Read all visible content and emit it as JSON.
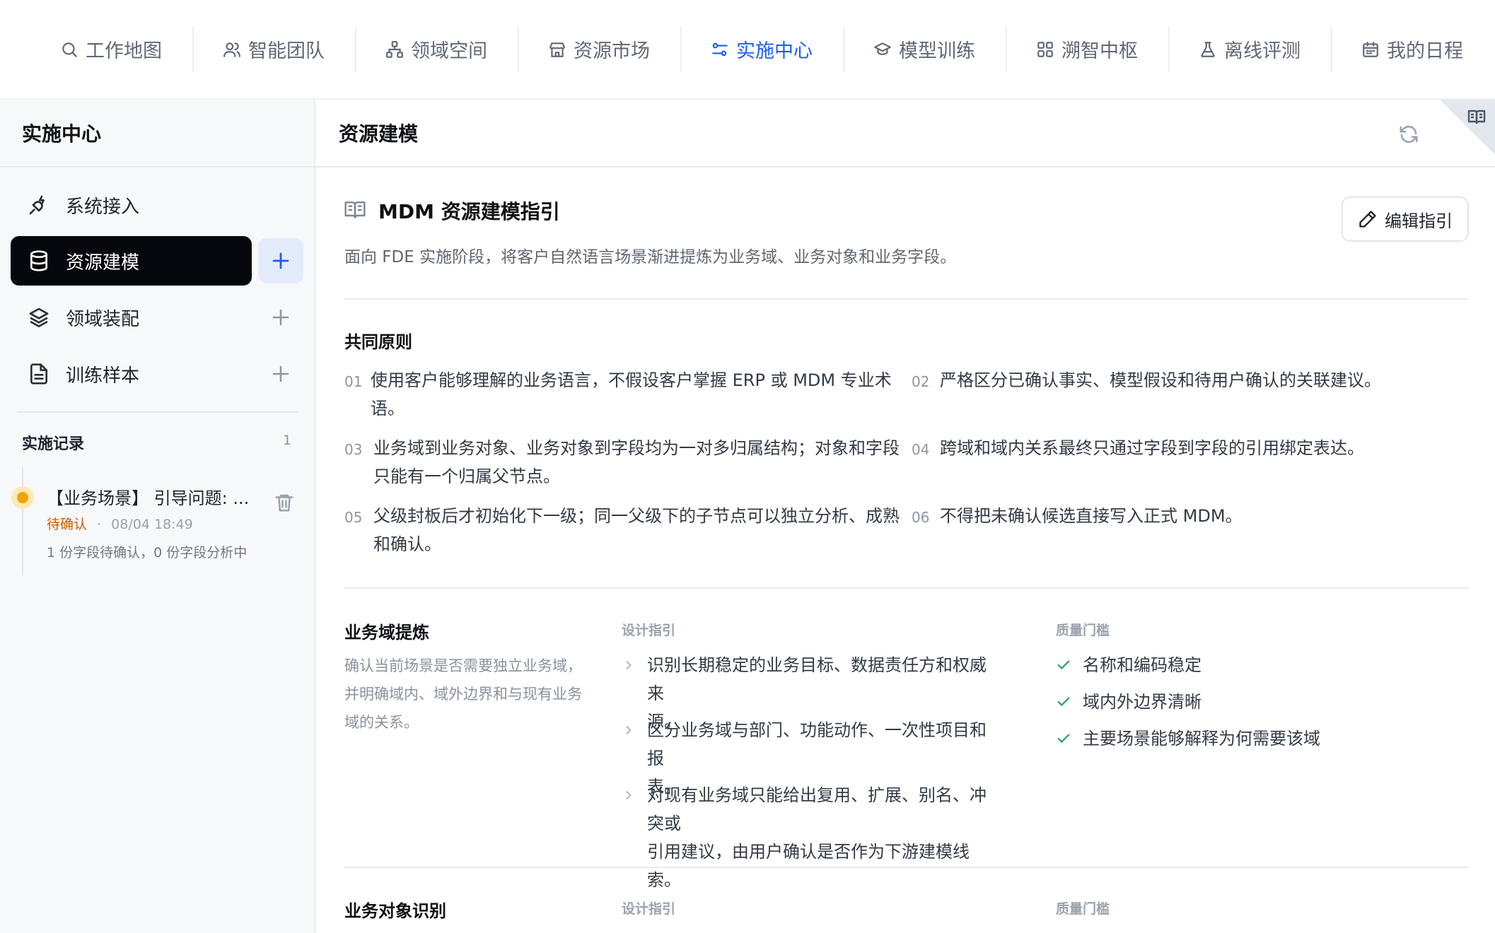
{
  "topnav": {
    "tabs": [
      {
        "label": "工作地图",
        "icon": "search-icon"
      },
      {
        "label": "智能团队",
        "icon": "users-icon"
      },
      {
        "label": "领域空间",
        "icon": "hierarchy-icon"
      },
      {
        "label": "资源市场",
        "icon": "store-icon"
      },
      {
        "label": "实施中心",
        "icon": "sliders-icon",
        "active": true
      },
      {
        "label": "模型训练",
        "icon": "graduation-cap-icon"
      },
      {
        "label": "溯智中枢",
        "icon": "grid-icon"
      },
      {
        "label": "离线评测",
        "icon": "flask-icon"
      },
      {
        "label": "我的日程",
        "icon": "calendar-icon"
      }
    ],
    "active_color": "#1d5cf5"
  },
  "sidebar": {
    "title": "实施中心",
    "items": [
      {
        "label": "系统接入",
        "icon": "plug-icon"
      },
      {
        "label": "资源建模",
        "icon": "database-icon",
        "active": true
      },
      {
        "label": "领域装配",
        "icon": "layers-icon"
      },
      {
        "label": "训练样本",
        "icon": "document-icon"
      }
    ],
    "records": {
      "title": "实施记录",
      "count": "1",
      "items": [
        {
          "name": "【业务场景】 引导问题: ...",
          "status": "待确认",
          "separator": "·",
          "time": "08/04 18:49",
          "desc": "1 份字段待确认，0 份字段分析中"
        }
      ]
    }
  },
  "main": {
    "title": "资源建模",
    "guide": {
      "title": "MDM 资源建模指引",
      "edit_label": "编辑指引",
      "subtitle": "面向 FDE 实施阶段，将客户自然语言场景渐进提炼为业务域、业务对象和业务字段。"
    },
    "principles": {
      "title": "共同原则",
      "items": [
        {
          "num": "01",
          "lines": [
            "使用客户能够理解的业务语言，不假设客户掌握 ERP 或 MDM 专业术",
            "语。"
          ]
        },
        {
          "num": "02",
          "lines": [
            "严格区分已确认事实、模型假设和待用户确认的关联建议。"
          ]
        },
        {
          "num": "03",
          "lines": [
            "业务域到业务对象、业务对象到字段均为一对多归属结构；对象和字段",
            "只能有一个归属父节点。"
          ]
        },
        {
          "num": "04",
          "lines": [
            "跨域和域内关系最终只通过字段到字段的引用绑定表达。"
          ]
        },
        {
          "num": "05",
          "lines": [
            "父级封板后才初始化下一级；同一父级下的子节点可以独立分析、成熟",
            "和确认。"
          ]
        },
        {
          "num": "06",
          "lines": [
            "不得把未确认候选直接写入正式 MDM。"
          ]
        }
      ]
    },
    "domain": {
      "title": "业务域提炼",
      "desc_lines": [
        "确认当前场景是否需要独立业务域，",
        "并明确域内、域外边界和与现有业务",
        "域的关系。"
      ],
      "design_label": "设计指引",
      "quality_label": "质量门槛",
      "design_items": [
        {
          "lines": [
            "识别长期稳定的业务目标、数据责任方和权威来",
            "源。"
          ]
        },
        {
          "lines": [
            "区分业务域与部门、功能动作、一次性项目和报",
            "表。"
          ]
        },
        {
          "lines": [
            "对现有业务域只能给出复用、扩展、别名、冲突或",
            "引用建议，由用户确认是否作为下游建模线索。"
          ]
        }
      ],
      "quality_items": [
        "名称和编码稳定",
        "域内外边界清晰",
        "主要场景能够解释为何需要该域"
      ]
    },
    "object": {
      "title": "业务对象识别",
      "design_label": "设计指引",
      "quality_label": "质量门槛"
    }
  }
}
